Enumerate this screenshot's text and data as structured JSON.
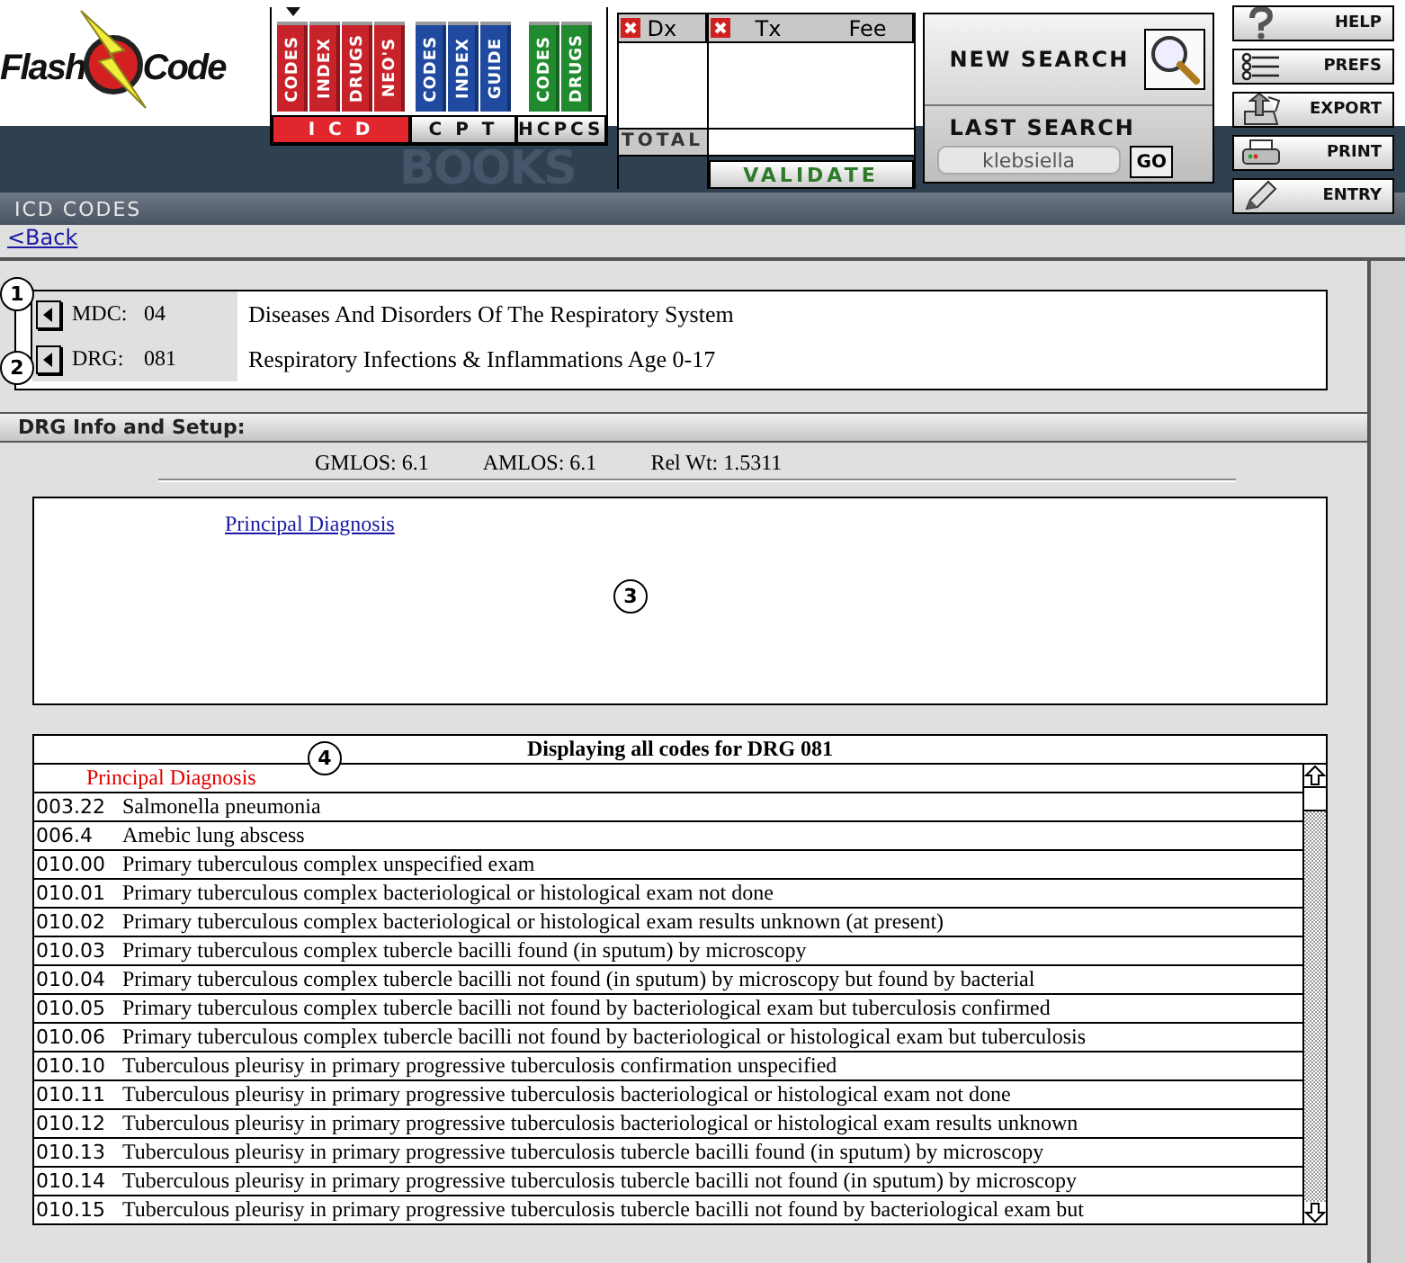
{
  "logo": {
    "text_1": "Flash",
    "text_2": "Code"
  },
  "banner_text": "BOOKS",
  "book_groups": [
    {
      "tab": "I C D",
      "selected": true,
      "color": "#c8222a",
      "books": [
        {
          "label": "CODES",
          "selected": true
        },
        {
          "label": "INDEX",
          "selected": false
        },
        {
          "label": "DRUGS",
          "selected": false
        },
        {
          "label": "NEO'S",
          "selected": false
        }
      ]
    },
    {
      "tab": "C P T",
      "selected": false,
      "color": "#1f4aa0",
      "books": [
        {
          "label": "CODES",
          "selected": false
        },
        {
          "label": "INDEX",
          "selected": false
        },
        {
          "label": "GUIDE",
          "selected": false
        }
      ]
    },
    {
      "tab": "HCPCS",
      "selected": false,
      "color": "#1f8a2e",
      "books": [
        {
          "label": "CODES",
          "selected": false
        },
        {
          "label": "DRUGS",
          "selected": false
        }
      ]
    }
  ],
  "cart": {
    "dx_header": "Dx",
    "tx_header": "Tx",
    "fee_header": "Fee",
    "total_label": "TOTAL",
    "validate_button": "VALIDATE"
  },
  "search": {
    "new_search_label": "NEW SEARCH",
    "last_search_label": "LAST SEARCH",
    "last_search_value": "klebsiella",
    "go_button": "GO"
  },
  "tools": [
    {
      "kind": "help",
      "label": "HELP"
    },
    {
      "kind": "prefs",
      "label": "PREFS"
    },
    {
      "kind": "export",
      "label": "EXPORT"
    },
    {
      "kind": "print",
      "label": "PRINT"
    },
    {
      "kind": "entry",
      "label": "ENTRY"
    }
  ],
  "section_title": "ICD CODES",
  "back_link": "<Back",
  "classification": [
    {
      "callout": "1",
      "label": "MDC:",
      "code": "04",
      "description": "Diseases And Disorders Of The Respiratory System"
    },
    {
      "callout": "2",
      "label": "DRG:",
      "code": "081",
      "description": "Respiratory Infections & Inflammations Age 0-17"
    }
  ],
  "setup": {
    "title": "DRG Info and Setup:",
    "stats": [
      {
        "label": "GMLOS:",
        "value": "6.1"
      },
      {
        "label": "AMLOS:",
        "value": "6.1"
      },
      {
        "label": "Rel Wt:",
        "value": "1.5311"
      }
    ],
    "principal_link": "Principal Diagnosis",
    "callout": "3"
  },
  "codes_table": {
    "title": "Displaying all codes for DRG 081",
    "callout": "4",
    "subheading": "Principal Diagnosis",
    "rows": [
      {
        "code": "003.22",
        "description": "Salmonella pneumonia"
      },
      {
        "code": "006.4",
        "description": "Amebic lung abscess"
      },
      {
        "code": "010.00",
        "description": "Primary tuberculous complex unspecified exam"
      },
      {
        "code": "010.01",
        "description": "Primary tuberculous complex bacteriological or histological exam not done"
      },
      {
        "code": "010.02",
        "description": "Primary tuberculous complex bacteriological or histological exam results unknown (at present)"
      },
      {
        "code": "010.03",
        "description": "Primary tuberculous complex tubercle bacilli found (in sputum) by microscopy"
      },
      {
        "code": "010.04",
        "description": "Primary tuberculous complex tubercle bacilli not found (in sputum) by microscopy but found by bacterial"
      },
      {
        "code": "010.05",
        "description": "Primary tuberculous complex tubercle bacilli not found by bacteriological exam but tuberculosis confirmed"
      },
      {
        "code": "010.06",
        "description": "Primary tuberculous complex tubercle bacilli not found by bacteriological or histological exam but tuberculosis"
      },
      {
        "code": "010.10",
        "description": "Tuberculous pleurisy in primary progressive tuberculosis confirmation unspecified"
      },
      {
        "code": "010.11",
        "description": "Tuberculous pleurisy in primary progressive tuberculosis bacteriological or histological exam not done"
      },
      {
        "code": "010.12",
        "description": "Tuberculous pleurisy in primary progressive tuberculosis bacteriological or histological exam results unknown"
      },
      {
        "code": "010.13",
        "description": "Tuberculous pleurisy in primary progressive tuberculosis tubercle bacilli found (in sputum) by microscopy"
      },
      {
        "code": "010.14",
        "description": "Tuberculous pleurisy in primary progressive tuberculosis tubercle bacilli not found (in sputum) by microscopy"
      },
      {
        "code": "010.15",
        "description": "Tuberculous pleurisy in primary progressive tuberculosis tubercle bacilli not found by bacteriological exam but"
      }
    ]
  }
}
